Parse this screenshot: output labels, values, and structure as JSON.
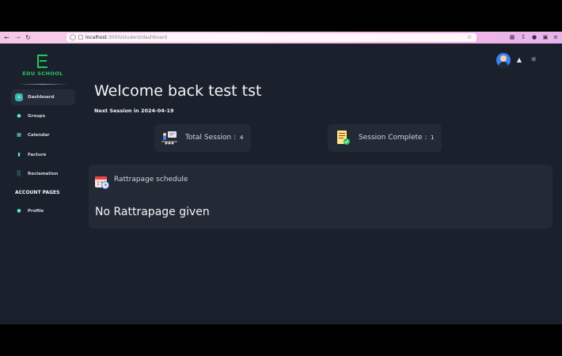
{
  "browser": {
    "url_host": "localhost",
    "url_path": ":3000/student/dashboard",
    "back_icon": "arrow-left-icon",
    "forward_icon": "arrow-right-icon",
    "reload_icon": "reload-icon",
    "shield_icon": "shield-icon",
    "page_icon": "page-icon",
    "bookmark_icon": "star-icon"
  },
  "brand": {
    "logo_letter": "E",
    "name": "EDU SCHOOL",
    "color": "#22c55e"
  },
  "sidebar": {
    "items": [
      {
        "label": "Dashboard",
        "icon": "home-icon",
        "active": true
      },
      {
        "label": "Groups",
        "icon": "users-icon",
        "active": false
      },
      {
        "label": "Calendar",
        "icon": "calendar-icon",
        "active": false
      },
      {
        "label": "Facture",
        "icon": "document-icon",
        "active": false
      },
      {
        "label": "Reclamation",
        "icon": "chart-icon",
        "active": false
      }
    ],
    "account_heading": "ACCOUNT PAGES",
    "account_items": [
      {
        "label": "Profile",
        "icon": "person-icon",
        "active": false
      }
    ]
  },
  "header": {
    "avatar_icon": "avatar-icon",
    "notification_icon": "bell-icon",
    "theme_icon": "sun-icon"
  },
  "main": {
    "welcome": "Welcome back test tst",
    "next_session": "Next Session in 2024-04-19",
    "stats": [
      {
        "label": "Total Session :",
        "value": "4",
        "icon": "presentation-icon"
      },
      {
        "label": "Session Complete :",
        "value": "1",
        "icon": "checklist-icon"
      }
    ],
    "rattrapage": {
      "title": "Rattrapage schedule",
      "icon": "calendar-clock-icon",
      "empty_text": "No Rattrapage given"
    }
  },
  "colors": {
    "background": "#1b212c",
    "card": "#232a36",
    "accent": "#38b2ac"
  }
}
